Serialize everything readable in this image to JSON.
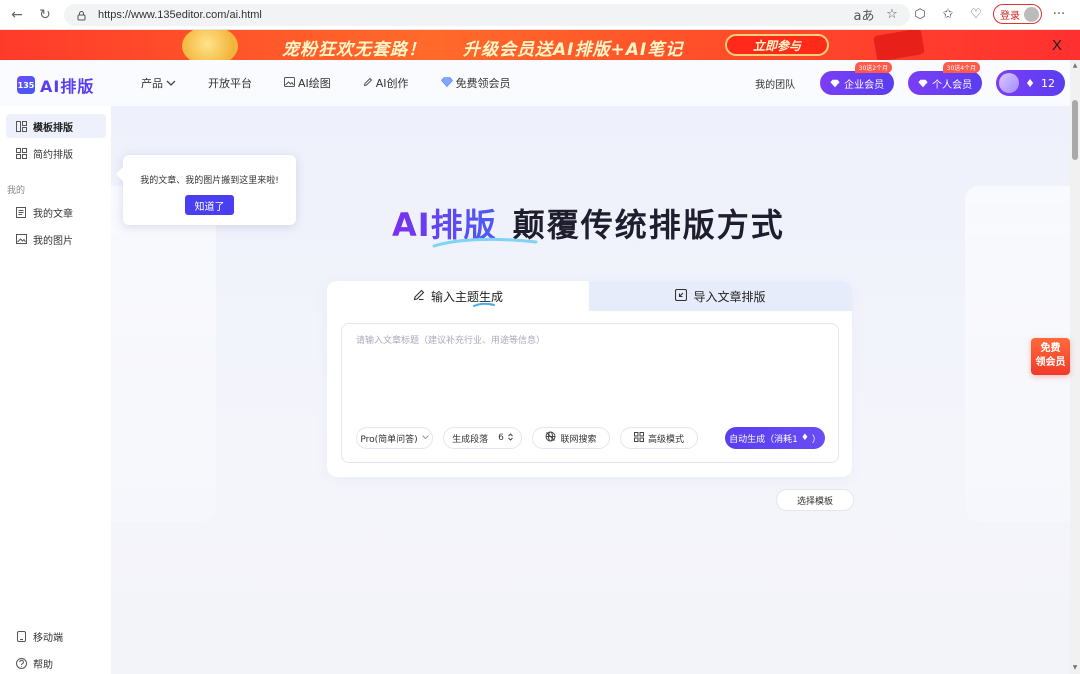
{
  "browser": {
    "url": "https://www.135editor.com/ai.html",
    "login_label": "登录"
  },
  "promo": {
    "text1": "宠粉狂欢无套路！",
    "text2": "升级会员送AI排版+AI笔记",
    "cta": "立即参与",
    "close": "X"
  },
  "header": {
    "logo_mark": "135",
    "logo_text": "AI排版",
    "nav": [
      {
        "label": "产品"
      },
      {
        "label": "开放平台"
      },
      {
        "label": "AI绘图"
      },
      {
        "label": "AI创作"
      },
      {
        "label": "免费领会员"
      }
    ],
    "team": "我的团队",
    "enterprise": {
      "label": "企业会员",
      "tag": "30送2个月"
    },
    "personal": {
      "label": "个人会员",
      "tag": "30送4个月"
    },
    "points": "12"
  },
  "sidebar": {
    "items": [
      {
        "label": "模板排版"
      },
      {
        "label": "简约排版"
      }
    ],
    "section": "我的",
    "my_items": [
      {
        "label": "我的文章"
      },
      {
        "label": "我的图片"
      }
    ],
    "bottom": [
      {
        "label": "移动端"
      },
      {
        "label": "帮助"
      }
    ]
  },
  "tooltip": {
    "message": "我的文章、我的图片搬到这里来啦!",
    "button": "知道了"
  },
  "hero": {
    "ai": "AI排版",
    "rest": "颠覆传统排版方式"
  },
  "panel": {
    "tab1": "输入主题生成",
    "tab2": "导入文章排版",
    "placeholder": "请输入文章标题（建议补充行业、用途等信息）",
    "mode": "Pro(简单问答)",
    "paragraphs_label": "生成段落",
    "paragraphs_value": "6",
    "web_search": "联网搜索",
    "advanced": "高级模式",
    "generate": "自动生成（消耗1",
    "generate_close": "）"
  },
  "choose_template": "选择模板",
  "free_vip": {
    "line1": "免费",
    "line2": "领会员"
  },
  "colors": {
    "accent": "#5a3df0",
    "promo": "#ff3a2a"
  }
}
